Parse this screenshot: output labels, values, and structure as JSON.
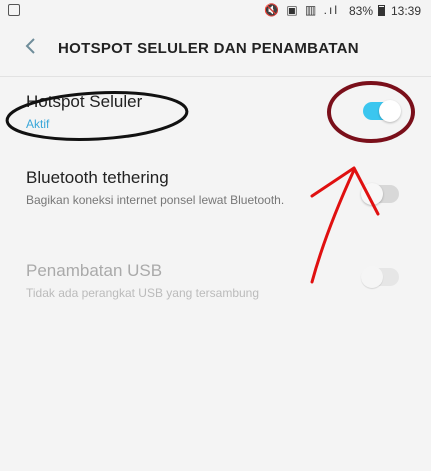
{
  "status_bar": {
    "icons": "🔇 ▣ ▥ .ıl",
    "battery": "83%",
    "time": "13:39"
  },
  "header": {
    "back_icon": "chevron-left",
    "title": "HOTSPOT SELULER DAN PENAMBATAN"
  },
  "settings": [
    {
      "title": "Hotspot Seluler",
      "subtitle": "Aktif",
      "enabled": true,
      "toggle_on": true
    },
    {
      "title": "Bluetooth tethering",
      "subtitle": "Bagikan koneksi internet ponsel lewat Bluetooth.",
      "enabled": true,
      "toggle_on": false
    },
    {
      "title": "Penambatan USB",
      "subtitle": "Tidak ada perangkat USB yang tersambung",
      "enabled": false,
      "toggle_on": false
    }
  ],
  "colors": {
    "toggle_on": "#3bc6ef",
    "annotation_ellipse_black": "#111111",
    "annotation_circle": "#7a0f1a",
    "annotation_arrow": "#e01010"
  }
}
